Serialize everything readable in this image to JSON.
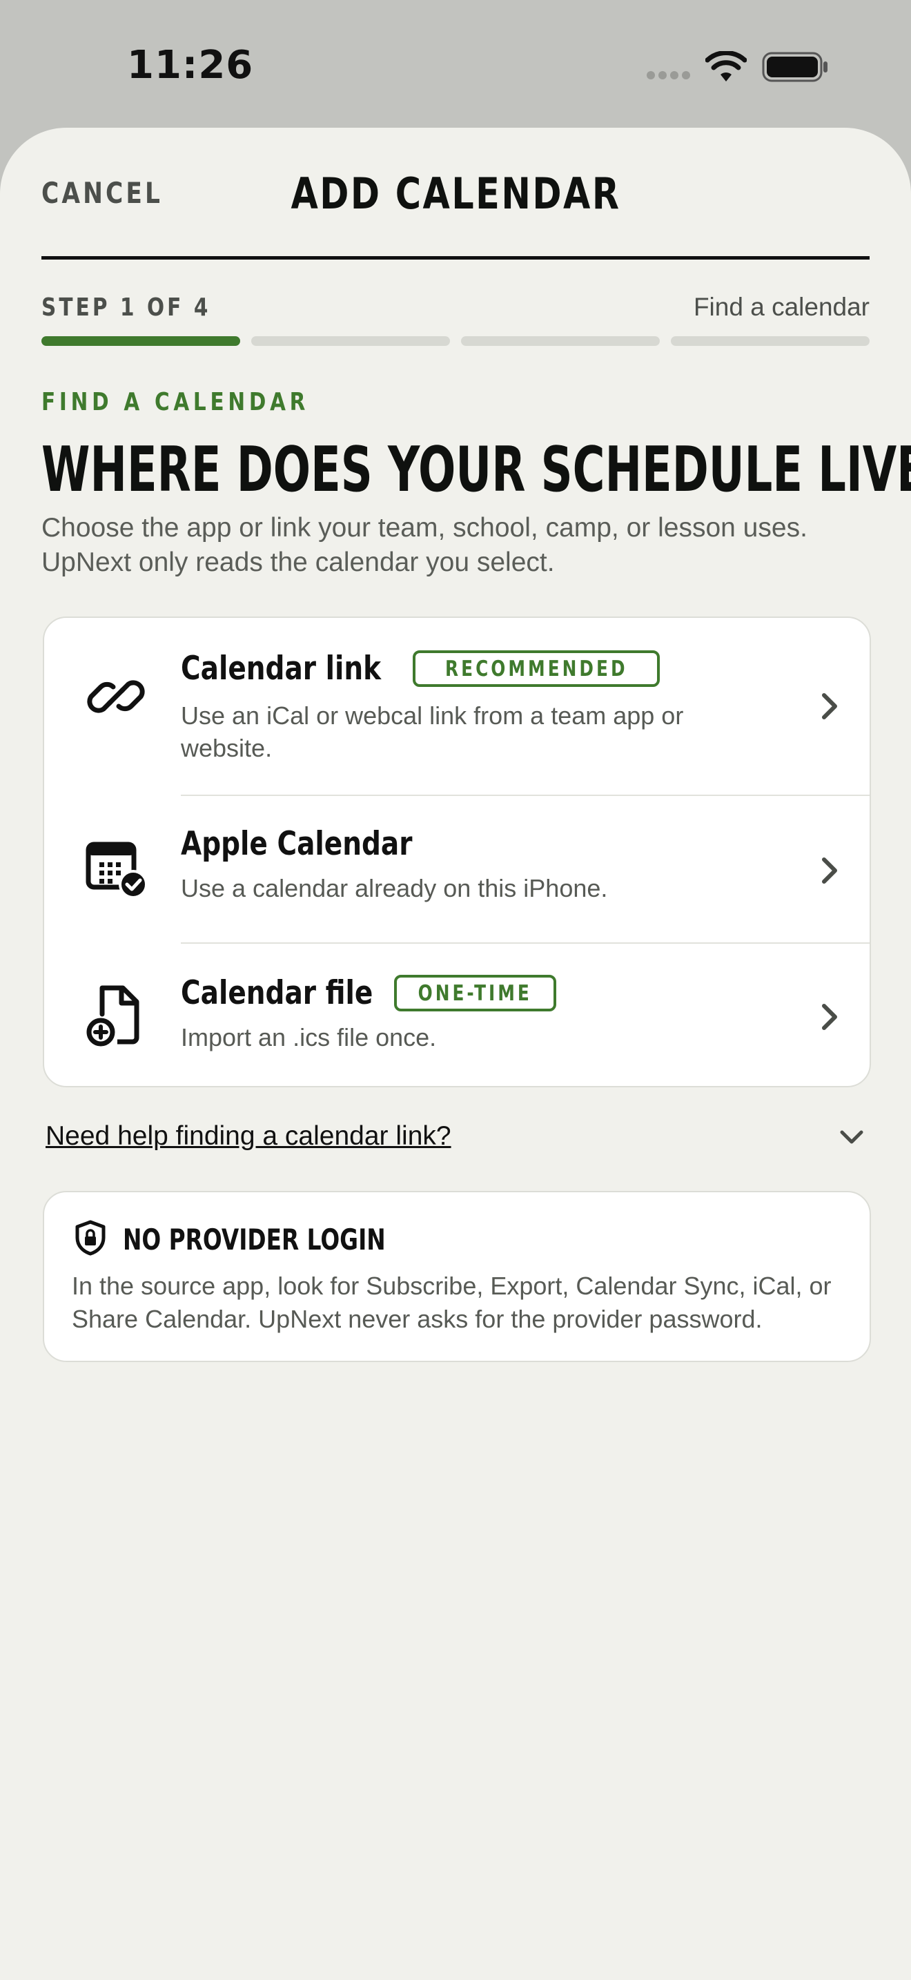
{
  "status_bar": {
    "time": "11:26",
    "icons": [
      "signal-dots-icon",
      "wifi-icon",
      "battery-icon"
    ]
  },
  "header": {
    "cancel_label": "CANCEL",
    "title": "ADD CALENDAR"
  },
  "progress": {
    "step_label": "STEP 1 OF 4",
    "step_name": "Find a calendar",
    "current_step": 1,
    "total_steps": 4
  },
  "intro": {
    "eyebrow": "FIND A CALENDAR",
    "headline": "WHERE DOES YOUR SCHEDULE LIVE?",
    "body": "Choose the app or link your team, school, camp, or lesson uses. UpNext only reads the calendar you select."
  },
  "options": [
    {
      "icon": "link-icon",
      "title": "Calendar link",
      "tag": "RECOMMENDED",
      "description": "Use an iCal or webcal link from a team app or website."
    },
    {
      "icon": "calendar-check-icon",
      "title": "Apple Calendar",
      "tag": "",
      "description": "Use a calendar already on this iPhone."
    },
    {
      "icon": "file-add-icon",
      "title": "Calendar file",
      "tag": "ONE-TIME",
      "description": "Import an .ics file once."
    }
  ],
  "help": {
    "link_label": "Need help finding a calendar link?"
  },
  "note": {
    "icon": "shield-lock-icon",
    "title": "NO PROVIDER LOGIN",
    "body": "In the source app, look for Subscribe, Export, Calendar Sync, iCal, or Share Calendar. UpNext never asks for the provider password."
  },
  "colors": {
    "accent": "#3f7a2d",
    "sheet_background": "#f1f1ec",
    "outer_background": "#c2c3bf",
    "text_primary": "#0f110f",
    "text_secondary": "#575a55"
  }
}
